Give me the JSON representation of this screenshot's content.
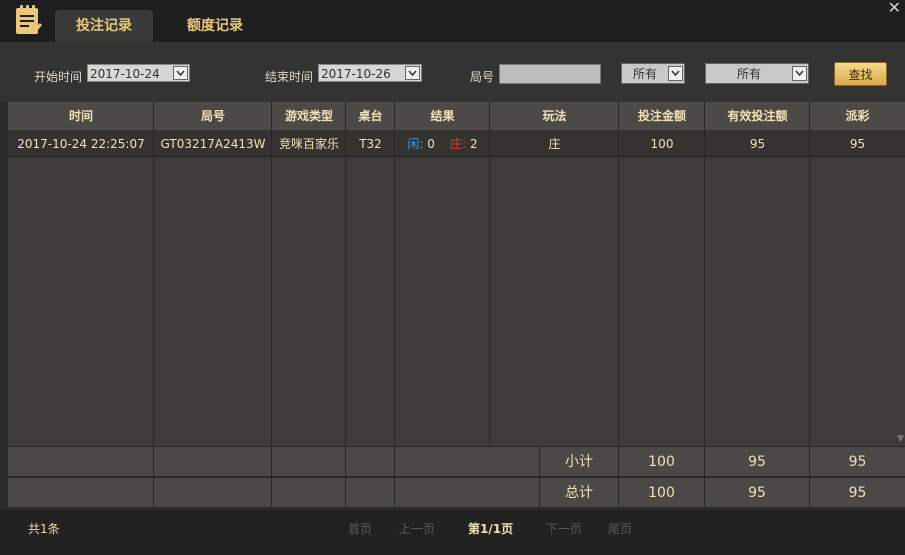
{
  "tabs": {
    "bet_records": "投注记录",
    "credit_records": "额度记录"
  },
  "filters": {
    "start_label": "开始时间",
    "start_value": "2017-10-24",
    "end_label": "结束时间",
    "end_value": "2017-10-26",
    "round_label": "局号",
    "round_value": "",
    "select1": "所有",
    "select2": "所有",
    "search_button": "查找"
  },
  "table": {
    "headers": [
      "时间",
      "局号",
      "游戏类型",
      "桌台",
      "结果",
      "玩法",
      "投注金额",
      "有效投注额",
      "派彩"
    ],
    "rows": [
      {
        "time": "2017-10-24 22:25:07",
        "round": "GT03217A2413W",
        "game": "竞咪百家乐",
        "table": "T32",
        "result_player_label": "闲:",
        "result_player": "0",
        "result_banker_label": "庄:",
        "result_banker": "2",
        "play": "庄",
        "bet": "100",
        "valid": "95",
        "payout": "95"
      }
    ]
  },
  "subtotal": {
    "label": "小计",
    "bet": "100",
    "valid": "95",
    "payout": "95"
  },
  "total": {
    "label": "总计",
    "bet": "100",
    "valid": "95",
    "payout": "95"
  },
  "pager": {
    "count": "共1条",
    "first": "首页",
    "prev": "上一页",
    "current": "第1/1页",
    "next": "下一页",
    "last": "尾页"
  },
  "colors": {
    "accent_gold": "#e8c87a",
    "player_blue": "#3a9be8",
    "banker_red": "#e83a3a"
  }
}
